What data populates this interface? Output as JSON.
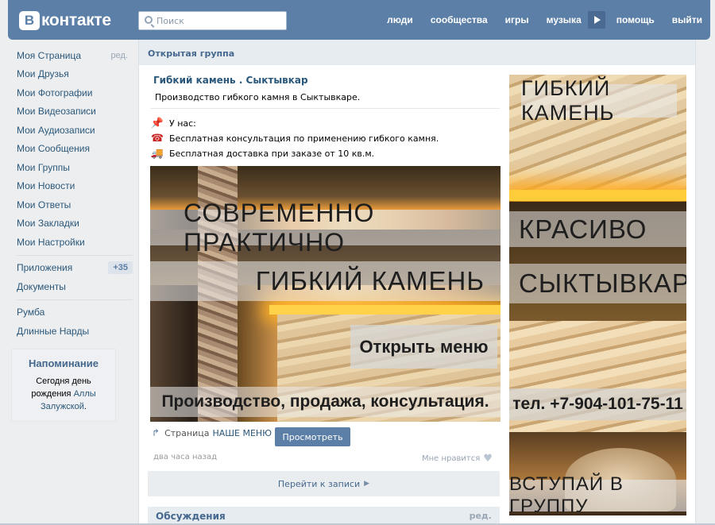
{
  "header": {
    "logo_letter": "В",
    "logo_text": "контакте",
    "search_placeholder": "Поиск",
    "nav": [
      "люди",
      "сообщества",
      "игры",
      "музыка",
      "помощь",
      "выйти"
    ]
  },
  "sidebar": {
    "edit_label": "ред.",
    "items": [
      "Моя Страница",
      "Мои Друзья",
      "Мои Фотографии",
      "Мои Видеозаписи",
      "Мои Аудиозаписи",
      "Мои Сообщения",
      "Мои Группы",
      "Мои Новости",
      "Мои Ответы",
      "Мои Закладки",
      "Мои Настройки"
    ],
    "apps_label": "Приложения",
    "apps_badge": "+35",
    "docs_label": "Документы",
    "games": [
      "Румба",
      "Длинные Нарды"
    ],
    "reminder": {
      "title": "Напоминание",
      "text_1": "Сегодня ",
      "link_1": "день рождения",
      "text_2": " ",
      "link_2": "Аллы Залужской",
      "text_3": "."
    }
  },
  "main": {
    "page_title": "Открытая группа",
    "group_name": "Гибкий камень . Сыктывкар",
    "group_desc": "Производство гибкого камня в Сыктывкаре.",
    "lines": [
      {
        "icon": "pushpin-icon",
        "glyph": "📌",
        "text": "У нас:"
      },
      {
        "icon": "telephone-icon",
        "glyph": "☎",
        "text": "Бесплатная консультация по применению гибкого камня."
      },
      {
        "icon": "truck-icon",
        "glyph": "🚚",
        "text": "Бесплатная доставка при заказе от 10 кв.м."
      }
    ],
    "banner": {
      "line1": "СОВРЕМЕННО ПРАКТИЧНО",
      "line2": "ГИБКИЙ КАМЕНЬ",
      "menu": "Открыть меню",
      "line4": "Производство, продажа, консультация."
    },
    "wiki_prefix": "Страница",
    "wiki_link": "НАШЕ МЕНЮ",
    "view_button": "Просмотреть",
    "post_time": "два часа назад",
    "like_label": "Мне нравится",
    "goto_post": "Перейти к записи",
    "discussions_title": "Обсуждения",
    "discussions_edit": "ред."
  },
  "side_banner": {
    "line1": "ГИБКИЙ КАМЕНЬ",
    "line2": "КРАСИВО",
    "line3": "СЫКТЫВКАР",
    "phone": "тел. +7-904-101-75-11",
    "join": "ВСТУПАЙ В ГРУППУ"
  }
}
